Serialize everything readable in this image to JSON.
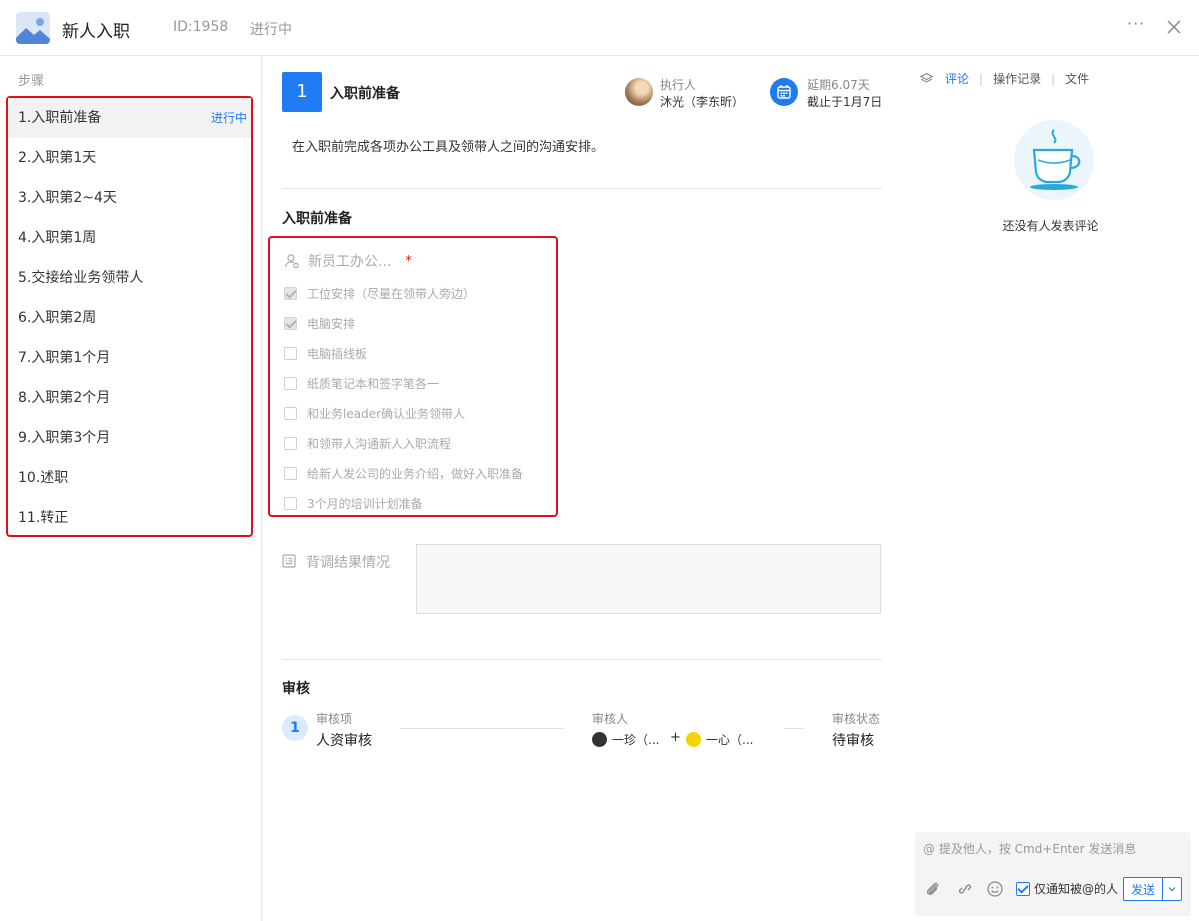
{
  "header": {
    "title": "新人入职",
    "id": "ID:1958",
    "status": "进行中",
    "more": "···"
  },
  "sidebar": {
    "title": "步骤",
    "items": [
      {
        "label": "1.入职前准备",
        "status": "进行中"
      },
      {
        "label": "2.入职第1天"
      },
      {
        "label": "3.入职第2~4天"
      },
      {
        "label": "4.入职第1周"
      },
      {
        "label": "5.交接给业务领带人"
      },
      {
        "label": "6.入职第2周"
      },
      {
        "label": "7.入职第1个月"
      },
      {
        "label": "8.入职第2个月"
      },
      {
        "label": "9.入职第3个月"
      },
      {
        "label": "10.述职"
      },
      {
        "label": "11.转正"
      }
    ]
  },
  "main": {
    "step_number": "1",
    "step_title": "入职前准备",
    "assignee_label": "执行人",
    "assignee_name": "沐光（李东昕）",
    "deadline_delay": "延期6.07天",
    "deadline_date": "截止于1月7日",
    "description": "在入职前完成各项办公工具及领带人之间的沟通安排。",
    "section_title": "入职前准备",
    "checklist": {
      "title": "新员工办公...",
      "required": "*",
      "items": [
        {
          "label": "工位安排（尽量在领带人旁边）",
          "checked": true
        },
        {
          "label": "电脑安排",
          "checked": true
        },
        {
          "label": "电脑插线板",
          "checked": false
        },
        {
          "label": "纸质笔记本和签字笔各一",
          "checked": false
        },
        {
          "label": "和业务leader确认业务领带人",
          "checked": false
        },
        {
          "label": "和领带人沟通新人入职流程",
          "checked": false
        },
        {
          "label": "给新人发公司的业务介绍，做好入职准备",
          "checked": false
        },
        {
          "label": "3个月的培训计划准备",
          "checked": false
        }
      ]
    },
    "background_check": {
      "label": "背调结果情况",
      "value": ""
    },
    "review": {
      "title": "审核",
      "step_number": "1",
      "item_label": "审核项",
      "item_value": "人资审核",
      "reviewer_label": "审核人",
      "reviewers": [
        "一珍（...",
        "一心（..."
      ],
      "plus": "+",
      "status_label": "审核状态",
      "status_value": "待审核"
    }
  },
  "right_panel": {
    "tabs": [
      "评论",
      "操作记录",
      "文件"
    ],
    "tab_separator": "|",
    "empty_text": "还没有人发表评论",
    "comment_placeholder": "@ 提及他人，按 Cmd+Enter 发送消息",
    "notify_label": "仅通知被@的人",
    "send_label": "发送"
  },
  "colors": {
    "accent": "#1f7bf2",
    "highlight_border": "#e0101a",
    "reviewer_1_avatar": "#333333",
    "reviewer_2_avatar": "#f5d300"
  }
}
